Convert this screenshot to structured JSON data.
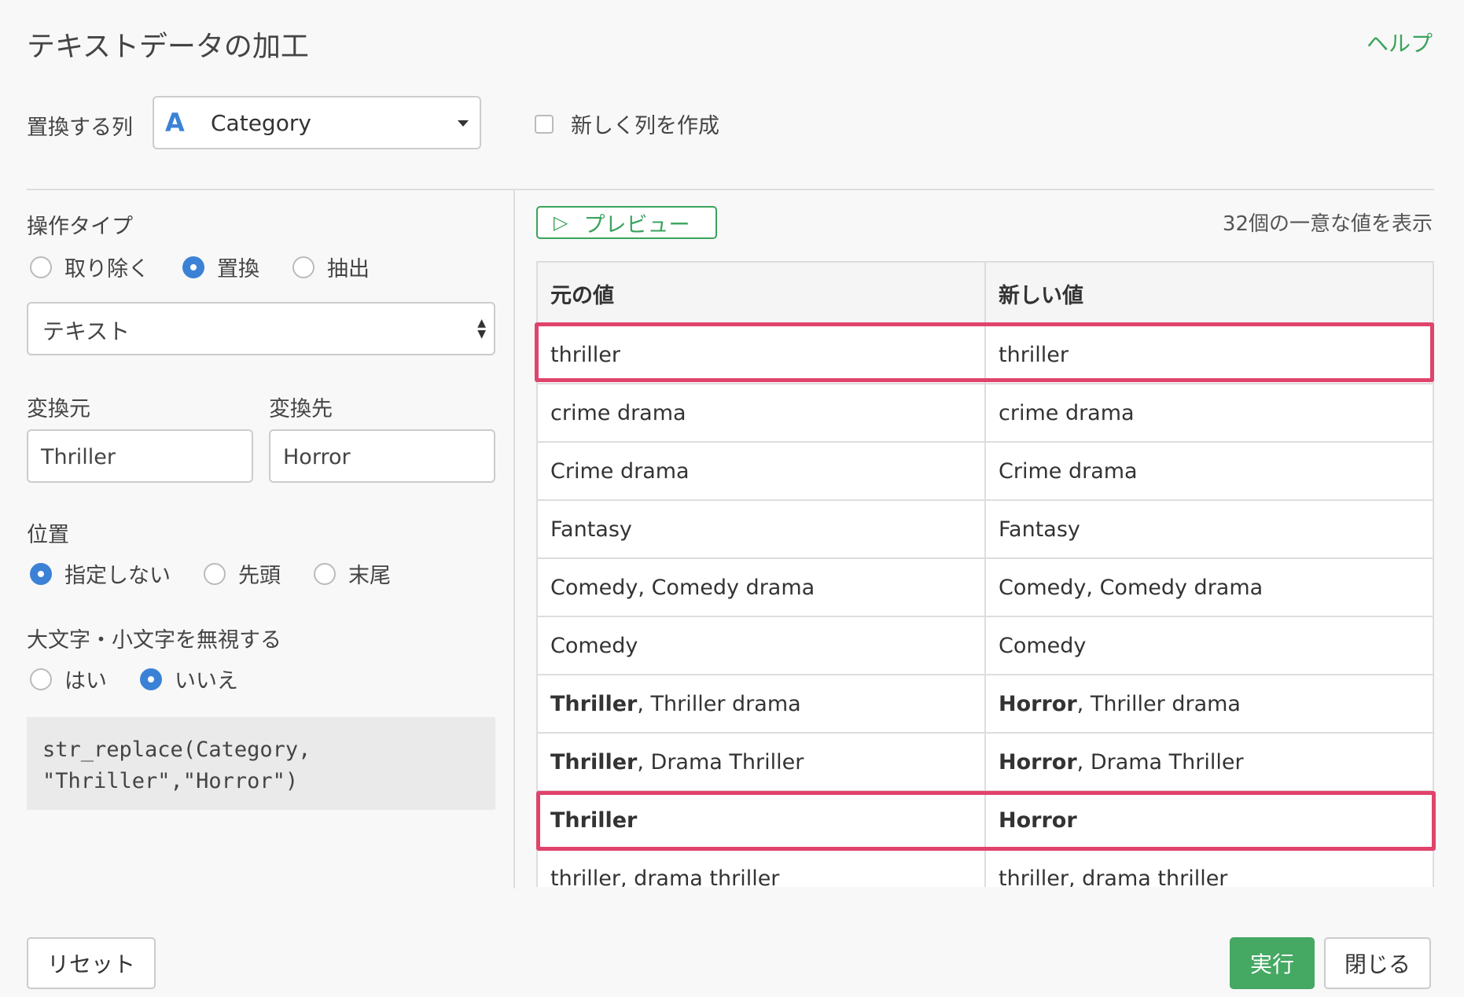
{
  "header": {
    "title": "テキストデータの加工",
    "help_link": "ヘルプ"
  },
  "column": {
    "label": "置換する列",
    "type_icon": "A",
    "selected": "Category",
    "new_column_label": "新しく列を作成"
  },
  "operation": {
    "label": "操作タイプ",
    "options": [
      {
        "label": "取り除く",
        "selected": false
      },
      {
        "label": "置換",
        "selected": true
      },
      {
        "label": "抽出",
        "selected": false
      }
    ],
    "mode": "テキスト"
  },
  "replace": {
    "from_label": "変換元",
    "to_label": "変換先",
    "from_value": "Thriller",
    "to_value": "Horror"
  },
  "position": {
    "label": "位置",
    "options": [
      {
        "label": "指定しない",
        "selected": true
      },
      {
        "label": "先頭",
        "selected": false
      },
      {
        "label": "末尾",
        "selected": false
      }
    ]
  },
  "case": {
    "label": "大文字・小文字を無視する",
    "options": [
      {
        "label": "はい",
        "selected": false
      },
      {
        "label": "いいえ",
        "selected": true
      }
    ]
  },
  "code": "str_replace(Category,\n\"Thriller\",\"Horror\")",
  "preview": {
    "button": "プレビュー",
    "count": "32個の一意な値を表示",
    "headers": [
      "元の値",
      "新しい値"
    ],
    "rows": [
      {
        "orig_bold": "",
        "orig_rest": "thriller",
        "new_bold": "",
        "new_rest": "thriller"
      },
      {
        "orig_bold": "",
        "orig_rest": "crime drama",
        "new_bold": "",
        "new_rest": "crime drama"
      },
      {
        "orig_bold": "",
        "orig_rest": "Crime drama",
        "new_bold": "",
        "new_rest": "Crime drama"
      },
      {
        "orig_bold": "",
        "orig_rest": "Fantasy",
        "new_bold": "",
        "new_rest": "Fantasy"
      },
      {
        "orig_bold": "",
        "orig_rest": "Comedy, Comedy drama",
        "new_bold": "",
        "new_rest": "Comedy, Comedy drama"
      },
      {
        "orig_bold": "",
        "orig_rest": "Comedy",
        "new_bold": "",
        "new_rest": "Comedy"
      },
      {
        "orig_bold": "Thriller",
        "orig_rest": ", Thriller drama",
        "new_bold": "Horror",
        "new_rest": ", Thriller drama"
      },
      {
        "orig_bold": "Thriller",
        "orig_rest": ", Drama Thriller",
        "new_bold": "Horror",
        "new_rest": ", Drama Thriller"
      },
      {
        "orig_bold": "Thriller",
        "orig_rest": "",
        "new_bold": "Horror",
        "new_rest": ""
      },
      {
        "orig_bold": "",
        "orig_rest": "thriller, drama thriller",
        "new_bold": "",
        "new_rest": "thriller, drama thriller"
      }
    ]
  },
  "footer": {
    "reset": "リセット",
    "run": "実行",
    "close": "閉じる"
  },
  "colors": {
    "accent_green": "#3aa35c",
    "radio_blue": "#3b82d6",
    "highlight": "#e0436c"
  }
}
